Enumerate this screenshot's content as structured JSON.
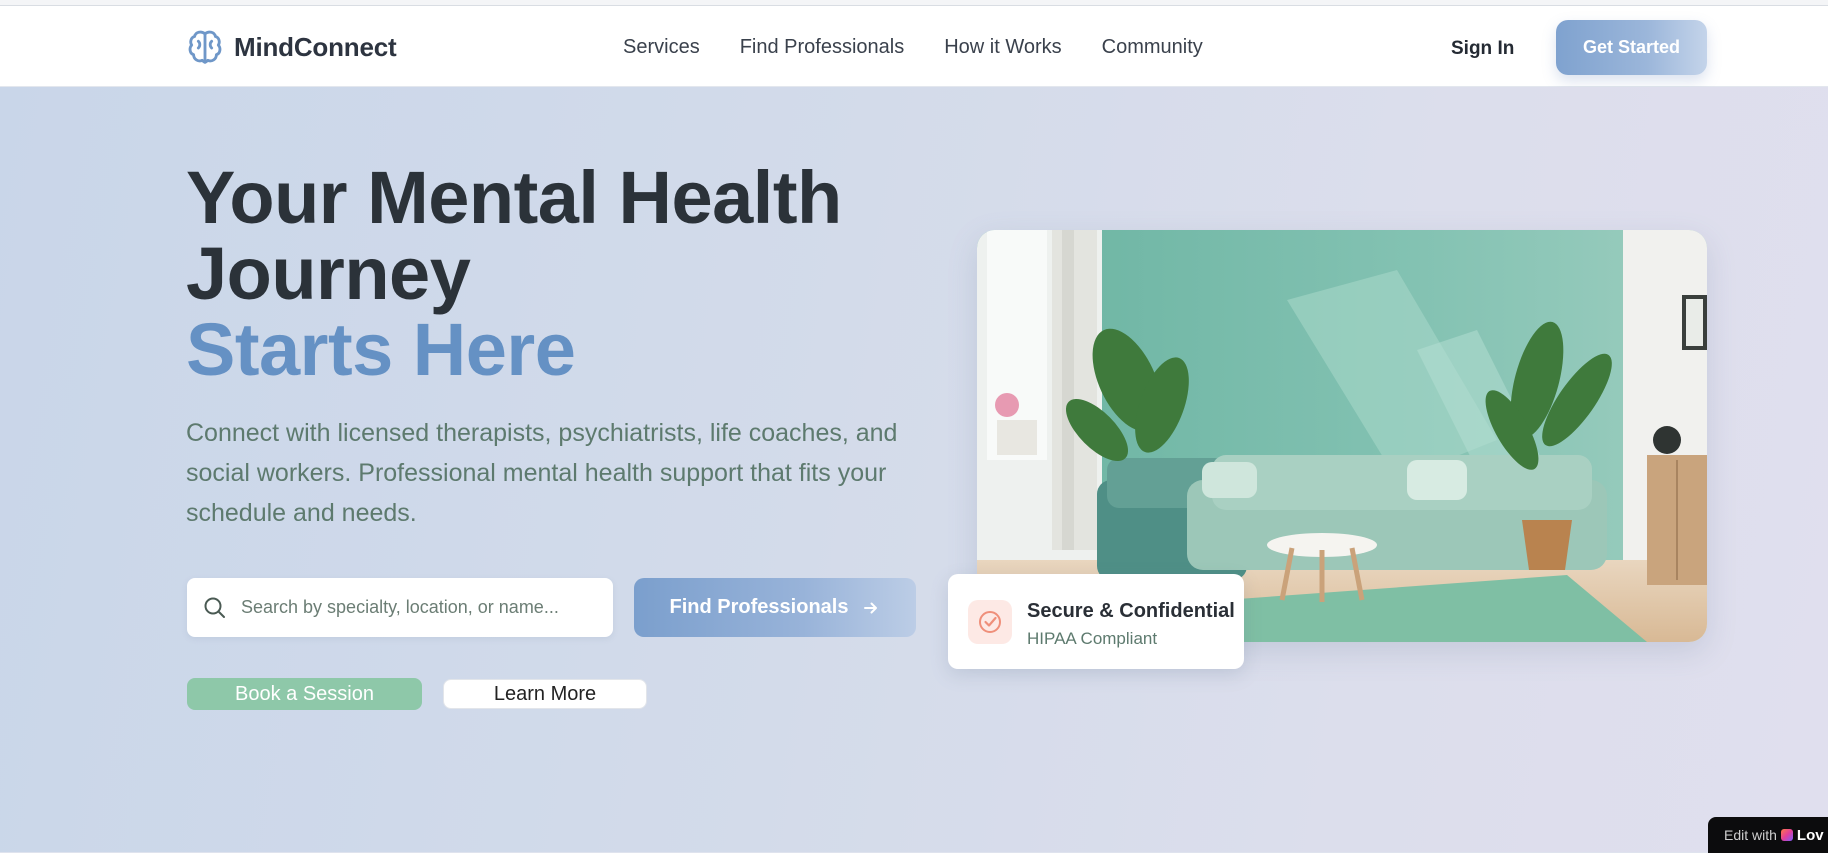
{
  "header": {
    "brand": "MindConnect",
    "nav": [
      "Services",
      "Find Professionals",
      "How it Works",
      "Community"
    ],
    "sign_in": "Sign In",
    "get_started": "Get Started"
  },
  "hero": {
    "title_line1": "Your Mental Health",
    "title_line2": "Journey",
    "title_line3": "Starts Here",
    "description": "Connect with licensed therapists, psychiatrists, life coaches, and social workers. Professional mental health support that fits your schedule and needs.",
    "search_placeholder": "Search by specialty, location, or name...",
    "find_button": "Find Professionals",
    "book_button": "Book a Session",
    "learn_button": "Learn More"
  },
  "badge": {
    "title": "Secure & Confidential",
    "subtitle": "HIPAA Compliant"
  },
  "edit_badge": {
    "prefix": "Edit with",
    "brand": "Lov"
  },
  "colors": {
    "accent_blue": "#6591c4",
    "accent_green": "#8ec8a9",
    "heading": "#2b3239",
    "body_text": "#5d7a6e"
  },
  "icons": [
    "brain-icon",
    "search-icon",
    "arrow-right-icon",
    "shield-check-icon",
    "heart-logo-icon"
  ]
}
